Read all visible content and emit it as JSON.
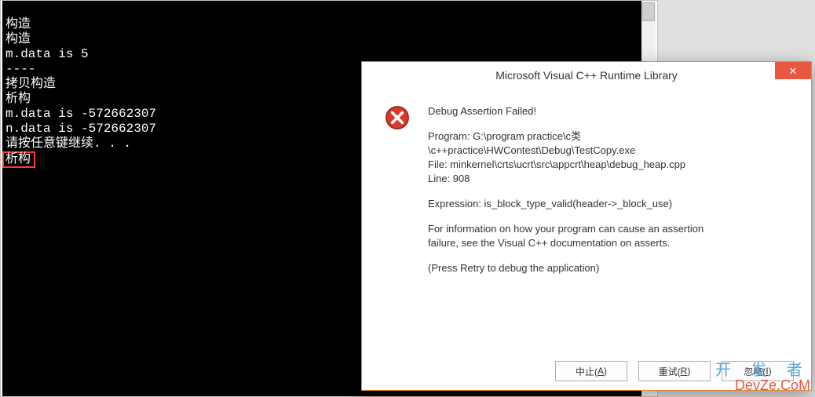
{
  "console": {
    "lines": [
      "构造",
      "构造",
      "m.data is 5",
      "----",
      "拷贝构造",
      "析构",
      "m.data is -572662307",
      "n.data is -572662307",
      "请按任意键继续. . ."
    ],
    "highlighted_line": "析构"
  },
  "dialog": {
    "title": "Microsoft Visual C++ Runtime Library",
    "close_glyph": "✕",
    "icon": "error-icon",
    "header": "Debug Assertion Failed!",
    "program_line1": "Program: G:\\program practice\\c类",
    "program_line2": "\\c++practice\\HWContest\\Debug\\TestCopy.exe",
    "file_line": "File: minkernel\\crts\\ucrt\\src\\appcrt\\heap\\debug_heap.cpp",
    "line_no": "Line: 908",
    "expression": "Expression: is_block_type_valid(header->_block_use)",
    "info1": "For information on how your program can cause an assertion",
    "info2": "failure, see the Visual C++ documentation on asserts.",
    "retry_hint": "(Press Retry to debug the application)",
    "buttons": {
      "abort_pre": "中止(",
      "abort_key": "A",
      "abort_post": ")",
      "retry_pre": "重试(",
      "retry_key": "R",
      "retry_post": ")",
      "ignore_pre": "忽略(",
      "ignore_key": "I",
      "ignore_post": ")"
    }
  },
  "watermark": {
    "cn": "开 发 者",
    "en": "DevZe.CoM"
  }
}
